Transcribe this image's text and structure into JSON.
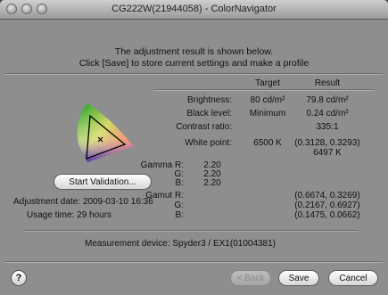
{
  "window": {
    "title": "CG222W(21944058) - ColorNavigator"
  },
  "header": {
    "line1": "The adjustment result is shown below.",
    "line2": "Click [Save] to store current settings and make a profile"
  },
  "columns": {
    "target": "Target",
    "result": "Result"
  },
  "rows": {
    "brightness": {
      "label": "Brightness:",
      "target": "80 cd/m²",
      "result": "79.8 cd/m²"
    },
    "black_level": {
      "label": "Black level:",
      "target": "Minimum",
      "result": "0.24 cd/m²"
    },
    "contrast": {
      "label": "Contrast ratio:",
      "result": "335:1"
    },
    "white_point": {
      "label": "White point:",
      "target": "6500 K",
      "result_xy": "(0.3128, 0.3293)",
      "result_k": "6497 K"
    },
    "gamma": {
      "label_r": "Gamma R:",
      "label_g": "G:",
      "label_b": "B:",
      "r": "2.20",
      "g": "2.20",
      "b": "2.20"
    },
    "gamut": {
      "label_r": "Gamut R:",
      "label_g": "G:",
      "label_b": "B:",
      "r": "(0.6674, 0.3269)",
      "g": "(0.2167, 0.6927)",
      "b": "(0.1475, 0.0662)"
    }
  },
  "validation_button": "Start Validation...",
  "adjustment_date": "Adjustment date: 2009-03-10 16:36",
  "usage_time": "Usage time: 29 hours",
  "measurement_device": "Measurement device:  Spyder3 / EX1(01004381)",
  "buttons": {
    "help": "?",
    "back": "< Back",
    "save": "Save",
    "cancel": "Cancel"
  }
}
